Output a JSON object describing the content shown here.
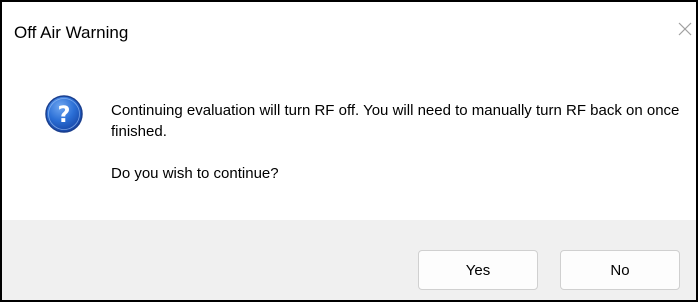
{
  "window": {
    "title": "Off Air Warning",
    "close_icon": "close-icon"
  },
  "dialog": {
    "icon": "question-icon",
    "message_line1": "Continuing evaluation will turn RF off. You will need to manually turn RF back on once finished.",
    "message_line2": "Do you wish to continue?"
  },
  "buttons": {
    "yes_label": "Yes",
    "no_label": "No"
  },
  "colors": {
    "icon_blue": "#2b6fd6",
    "footer_bg": "#f0f0f0"
  }
}
